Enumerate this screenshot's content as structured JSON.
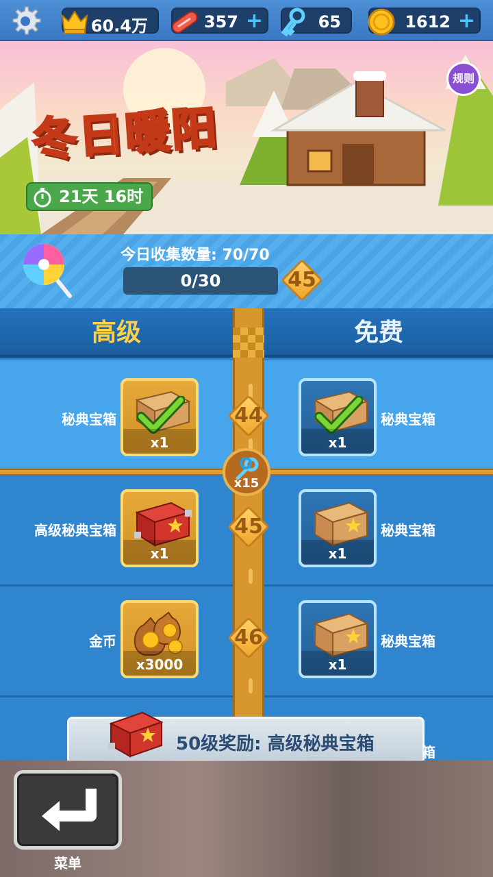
{
  "topbar": {
    "trophy_value": "60.4万",
    "tickets_value": "357",
    "keys_value": "65",
    "coins_value": "1612",
    "plus_glyph": "+"
  },
  "banner": {
    "title": "冬日暖阳",
    "timer": "21天 16时",
    "rules": "规则"
  },
  "collect": {
    "label": "今日收集数量: 70/70",
    "progress_text": "0/30",
    "progress_fraction": 0.0,
    "target_level": "45"
  },
  "columns": {
    "premium": "高级",
    "free": "免费"
  },
  "rows": [
    {
      "level": "44",
      "premium": {
        "name": "秘典宝箱",
        "qty": "x1",
        "claimed": true
      },
      "free": {
        "name": "秘典宝箱",
        "qty": "x1",
        "claimed": true
      }
    },
    {
      "level": "45",
      "premium": {
        "name": "高级秘典宝箱",
        "qty": "x1",
        "claimed": false
      },
      "free": {
        "name": "秘典宝箱",
        "qty": "x1",
        "claimed": false
      }
    },
    {
      "level": "46",
      "premium": {
        "name": "金币",
        "qty": "x3000",
        "claimed": false
      },
      "free": {
        "name": "秘典宝箱",
        "qty": "x1",
        "claimed": false
      }
    },
    {
      "free": {
        "name": "秘典宝箱"
      }
    }
  ],
  "key_reward": "x15",
  "level50": "50级奖励: 高级秘典宝箱",
  "menu_label": "菜单",
  "colors": {
    "topbar": "#3a78c4",
    "panel_blue": "#2f86cf",
    "highlight_row": "#47a5ec",
    "gold": "#d8962e",
    "timer_green": "#4aa84a",
    "rules_purple": "#8a4fd3"
  }
}
